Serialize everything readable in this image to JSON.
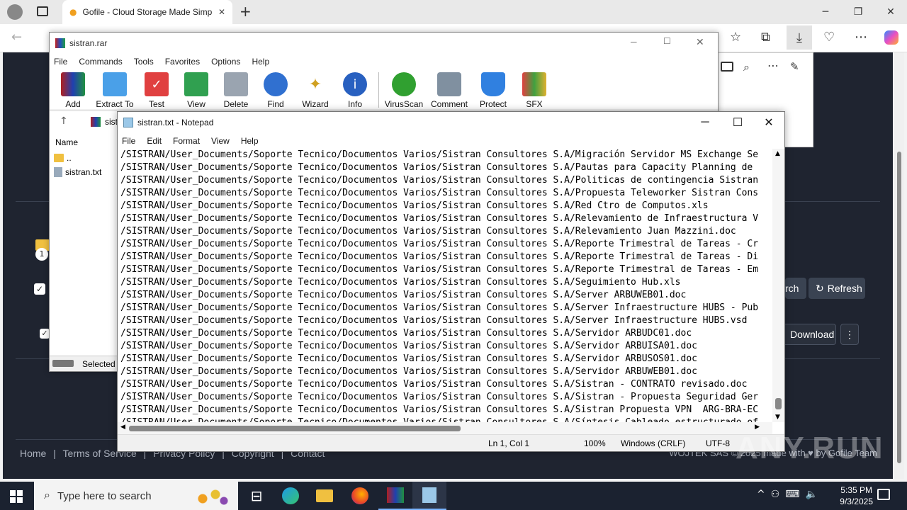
{
  "browser": {
    "tab_title": "Gofile - Cloud Storage Made Simp",
    "new_tab": "+",
    "minimize": "─",
    "maximize": "❐",
    "close": "✕"
  },
  "webpage": {
    "footer_links": [
      "Home",
      "Terms of Service",
      "Privacy Policy",
      "Copyright",
      "Contact"
    ],
    "footer_separator": "|",
    "footer_right": "WOJTEK SAS © 2025 made with ♥ by Gofile Team",
    "search_partial": "rch",
    "refresh_label": "Refresh",
    "download_label": "Download",
    "badge_one": "1"
  },
  "winrar": {
    "title": "sistran.rar",
    "menu": [
      "File",
      "Commands",
      "Tools",
      "Favorites",
      "Options",
      "Help"
    ],
    "tools": [
      {
        "label": "Add",
        "icon": "add-archive-icon"
      },
      {
        "label": "Extract To",
        "icon": "extract-folder-icon"
      },
      {
        "label": "Test",
        "icon": "test-clipboard-icon"
      },
      {
        "label": "View",
        "icon": "view-book-icon"
      },
      {
        "label": "Delete",
        "icon": "trash-icon"
      },
      {
        "label": "Find",
        "icon": "magnifier-icon"
      },
      {
        "label": "Wizard",
        "icon": "wizard-wand-icon"
      },
      {
        "label": "Info",
        "icon": "info-icon"
      },
      {
        "label": "VirusScan",
        "icon": "virus-scan-icon"
      },
      {
        "label": "Comment",
        "icon": "comment-icon"
      },
      {
        "label": "Protect",
        "icon": "shield-icon"
      },
      {
        "label": "SFX",
        "icon": "sfx-box-icon"
      }
    ],
    "path_partial": "sist",
    "column_name": "Name",
    "files": [
      "..",
      "sistran.txt"
    ],
    "status_selected": "Selected"
  },
  "notepad": {
    "title": "sistran.txt - Notepad",
    "menu": [
      "File",
      "Edit",
      "Format",
      "View",
      "Help"
    ],
    "lines": [
      "/SISTRAN/User_Documents/Soporte Tecnico/Documentos Varios/Sistran Consultores S.A/Migración Servidor MS Exchange Se",
      "/SISTRAN/User_Documents/Soporte Tecnico/Documentos Varios/Sistran Consultores S.A/Pautas para Capacity Planning de",
      "/SISTRAN/User_Documents/Soporte Tecnico/Documentos Varios/Sistran Consultores S.A/Politicas de contingencia Sistran",
      "/SISTRAN/User_Documents/Soporte Tecnico/Documentos Varios/Sistran Consultores S.A/Propuesta Teleworker Sistran Cons",
      "/SISTRAN/User_Documents/Soporte Tecnico/Documentos Varios/Sistran Consultores S.A/Red Ctro de Computos.xls",
      "/SISTRAN/User_Documents/Soporte Tecnico/Documentos Varios/Sistran Consultores S.A/Relevamiento de Infraestructura V",
      "/SISTRAN/User_Documents/Soporte Tecnico/Documentos Varios/Sistran Consultores S.A/Relevamiento Juan Mazzini.doc",
      "/SISTRAN/User_Documents/Soporte Tecnico/Documentos Varios/Sistran Consultores S.A/Reporte Trimestral de Tareas - Cr",
      "/SISTRAN/User_Documents/Soporte Tecnico/Documentos Varios/Sistran Consultores S.A/Reporte Trimestral de Tareas - Di",
      "/SISTRAN/User_Documents/Soporte Tecnico/Documentos Varios/Sistran Consultores S.A/Reporte Trimestral de Tareas - Em",
      "/SISTRAN/User_Documents/Soporte Tecnico/Documentos Varios/Sistran Consultores S.A/Seguimiento Hub.xls",
      "/SISTRAN/User_Documents/Soporte Tecnico/Documentos Varios/Sistran Consultores S.A/Server ARBUWEB01.doc",
      "/SISTRAN/User_Documents/Soporte Tecnico/Documentos Varios/Sistran Consultores S.A/Server Infraestructure HUBS - Pub",
      "/SISTRAN/User_Documents/Soporte Tecnico/Documentos Varios/Sistran Consultores S.A/Server Infraestructure HUBS.vsd",
      "/SISTRAN/User_Documents/Soporte Tecnico/Documentos Varios/Sistran Consultores S.A/Servidor ARBUDC01.doc",
      "/SISTRAN/User_Documents/Soporte Tecnico/Documentos Varios/Sistran Consultores S.A/Servidor ARBUISA01.doc",
      "/SISTRAN/User_Documents/Soporte Tecnico/Documentos Varios/Sistran Consultores S.A/Servidor ARBUSOS01.doc",
      "/SISTRAN/User_Documents/Soporte Tecnico/Documentos Varios/Sistran Consultores S.A/Servidor ARBUWEB01.doc",
      "/SISTRAN/User_Documents/Soporte Tecnico/Documentos Varios/Sistran Consultores S.A/Sistran - CONTRATO revisado.doc",
      "/SISTRAN/User_Documents/Soporte Tecnico/Documentos Varios/Sistran Consultores S.A/Sistran - Propuesta Seguridad Ger",
      "/SISTRAN/User_Documents/Soporte Tecnico/Documentos Varios/Sistran Consultores S.A/Sistran Propuesta VPN  ARG-BRA-EC",
      "/SISTRAN/User_Documents/Soporte Tecnico/Documentos Varios/Sistran Consultores S.A/Síntesis Cableado estructurado of"
    ],
    "status": {
      "position": "Ln 1, Col 1",
      "zoom": "100%",
      "line_ending": "Windows (CRLF)",
      "encoding": "UTF-8"
    }
  },
  "taskbar": {
    "search_placeholder": "Type here to search",
    "time": "5:35 PM",
    "date": "9/3/2025"
  },
  "watermark": "ANY.RUN"
}
